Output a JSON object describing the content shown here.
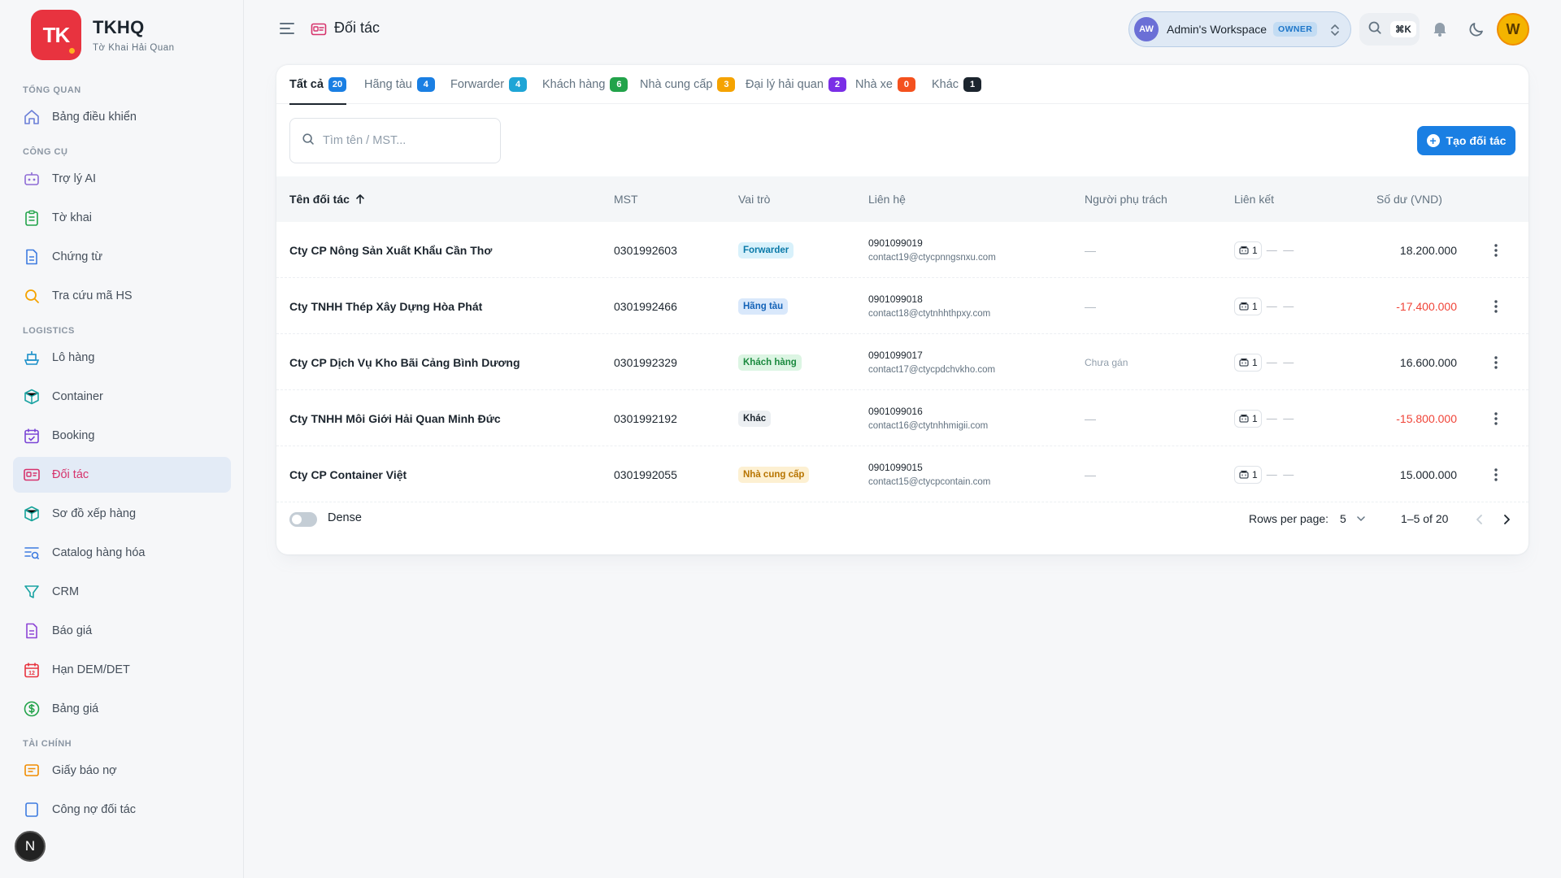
{
  "brand": {
    "logo_text": "TK",
    "title": "TKHQ",
    "subtitle": "Tờ Khai Hải Quan"
  },
  "nav": {
    "sections": [
      {
        "label": "TỔNG QUAN",
        "items": [
          {
            "label": "Bảng điều khiển",
            "icon": "home-icon"
          }
        ]
      },
      {
        "label": "CÔNG CỤ",
        "items": [
          {
            "label": "Trợ lý AI",
            "icon": "robot-icon"
          },
          {
            "label": "Tờ khai",
            "icon": "clipboard-icon"
          },
          {
            "label": "Chứng từ",
            "icon": "document-icon"
          },
          {
            "label": "Tra cứu mã HS",
            "icon": "search-icon"
          }
        ]
      },
      {
        "label": "LOGISTICS",
        "items": [
          {
            "label": "Lô hàng",
            "icon": "ship-icon"
          },
          {
            "label": "Container",
            "icon": "box-icon"
          },
          {
            "label": "Booking",
            "icon": "calendar-check-icon"
          },
          {
            "label": "Đối tác",
            "icon": "id-card-icon",
            "active": true
          },
          {
            "label": "Sơ đồ xếp hàng",
            "icon": "cube-icon"
          },
          {
            "label": "Catalog hàng hóa",
            "icon": "list-search-icon"
          },
          {
            "label": "CRM",
            "icon": "funnel-icon"
          },
          {
            "label": "Báo giá",
            "icon": "file-text-icon"
          },
          {
            "label": "Hạn DEM/DET",
            "icon": "calendar-12-icon"
          },
          {
            "label": "Bảng giá",
            "icon": "dollar-circle-icon"
          }
        ]
      },
      {
        "label": "TÀI CHÍNH",
        "items": [
          {
            "label": "Giấy báo nợ",
            "icon": "message-list-icon"
          },
          {
            "label": "Công nợ đối tác",
            "icon": "ledger-icon"
          }
        ]
      }
    ],
    "floating_badge": "N"
  },
  "topbar": {
    "page_title": "Đối tác",
    "workspace": {
      "avatar": "AW",
      "name": "Admin's Workspace",
      "role": "OWNER"
    },
    "search_shortcut": "⌘K",
    "user_avatar": "W"
  },
  "tabs": [
    {
      "label": "Tất cả",
      "count": "20",
      "color": "#1a7fe3",
      "active": true
    },
    {
      "label": "Hãng tàu",
      "count": "4",
      "color": "#1a7fe3"
    },
    {
      "label": "Forwarder",
      "count": "4",
      "color": "#1fa5d6"
    },
    {
      "label": "Khách hàng",
      "count": "6",
      "color": "#22a34a"
    },
    {
      "label": "Nhà cung cấp",
      "count": "3",
      "color": "#f5a300"
    },
    {
      "label": "Đại lý hải quan",
      "count": "2",
      "color": "#7a2ee6"
    },
    {
      "label": "Nhà xe",
      "count": "0",
      "color": "#f4511e"
    },
    {
      "label": "Khác",
      "count": "1",
      "color": "#1c252e"
    }
  ],
  "search": {
    "placeholder": "Tìm tên / MST..."
  },
  "create_button": "Tạo đối tác",
  "table": {
    "headers": {
      "name": "Tên đối tác",
      "mst": "MST",
      "role": "Vai trò",
      "contact": "Liên hệ",
      "owner": "Người phụ trách",
      "link": "Liên kết",
      "balance": "Số dư (VND)"
    },
    "rows": [
      {
        "name": "Cty CP Nông Sản Xuất Khẩu Cần Thơ",
        "mst": "0301992603",
        "role": "Forwarder",
        "role_bg": "#d8f1fb",
        "role_fg": "#0a79a8",
        "phone": "0901099019",
        "email": "contact19@ctycpnngsnxu.com",
        "owner": "—",
        "link_count": "1",
        "link_rest": "— —",
        "balance": "18.200.000",
        "negative": false
      },
      {
        "name": "Cty TNHH Thép Xây Dựng Hòa Phát",
        "mst": "0301992466",
        "role": "Hãng tàu",
        "role_bg": "#d9e8fb",
        "role_fg": "#1463b8",
        "phone": "0901099018",
        "email": "contact18@ctytnhhthpxy.com",
        "owner": "—",
        "link_count": "1",
        "link_rest": "— —",
        "balance": "-17.400.000",
        "negative": true
      },
      {
        "name": "Cty CP Dịch Vụ Kho Bãi Cảng Bình Dương",
        "mst": "0301992329",
        "role": "Khách hàng",
        "role_bg": "#dcf5e3",
        "role_fg": "#1b8a3f",
        "phone": "0901099017",
        "email": "contact17@ctycpdchvkho.com",
        "owner": "Chưa gán",
        "link_count": "1",
        "link_rest": "— —",
        "balance": "16.600.000",
        "negative": false
      },
      {
        "name": "Cty TNHH Môi Giới Hải Quan Minh Đức",
        "mst": "0301992192",
        "role": "Khác",
        "role_bg": "#eceff2",
        "role_fg": "#1c252e",
        "phone": "0901099016",
        "email": "contact16@ctytnhhmigii.com",
        "owner": "—",
        "link_count": "1",
        "link_rest": "— —",
        "balance": "-15.800.000",
        "negative": true
      },
      {
        "name": "Cty CP Container Việt",
        "mst": "0301992055",
        "role": "Nhà cung cấp",
        "role_bg": "#fdf0d2",
        "role_fg": "#b77400",
        "phone": "0901099015",
        "email": "contact15@ctycpcontain.com",
        "owner": "—",
        "link_count": "1",
        "link_rest": "— —",
        "balance": "15.000.000",
        "negative": false
      }
    ]
  },
  "footer": {
    "dense_label": "Dense",
    "rows_per_page_label": "Rows per page:",
    "rows_per_page": "5",
    "range": "1–5 of 20"
  }
}
